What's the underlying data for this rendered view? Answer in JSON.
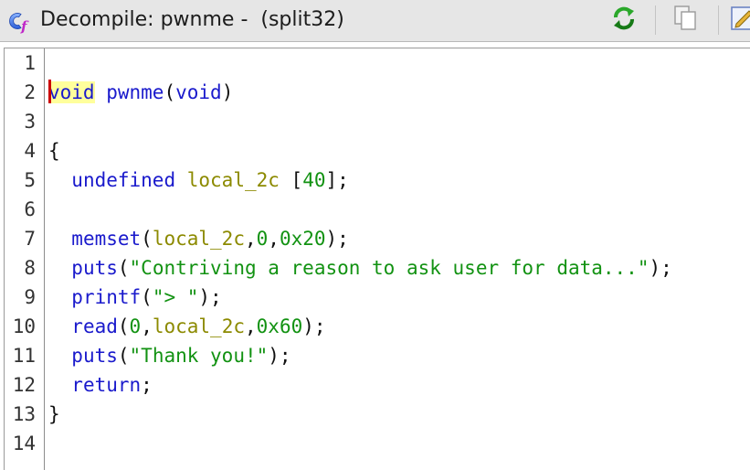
{
  "window": {
    "icon": "decompiler-cf-icon",
    "title": "Decompile: pwnme -  (split32)",
    "toolbar": [
      {
        "icon": "refresh-icon",
        "label": "Refresh"
      },
      {
        "icon": "copy-icon",
        "label": "Copy"
      },
      {
        "icon": "edit-icon",
        "label": "Edit"
      }
    ]
  },
  "colors": {
    "keyword": "#1a1acc",
    "variable": "#8c8a00",
    "literal": "#129212",
    "highlight": "#ffff9c",
    "cursor": "#cc0000"
  },
  "editor": {
    "line_numbers": [
      "1",
      "2",
      "3",
      "4",
      "5",
      "6",
      "7",
      "8",
      "9",
      "10",
      "11",
      "12",
      "13",
      "14"
    ],
    "lines": {
      "l2": {
        "t1": "void",
        "t2": " ",
        "t3": "pwnme",
        "t4": "(",
        "t5": "void",
        "t6": ")"
      },
      "l4": {
        "t1": "{"
      },
      "l5": {
        "t0": "  ",
        "t1": "undefined",
        "t2": " ",
        "t3": "local_2c",
        "t4": " [",
        "t5": "40",
        "t6": "];"
      },
      "l7": {
        "t0": "  ",
        "t1": "memset",
        "t2": "(",
        "t3": "local_2c",
        "t4": ",",
        "t5": "0",
        "t6": ",",
        "t7": "0x20",
        "t8": ");"
      },
      "l8": {
        "t0": "  ",
        "t1": "puts",
        "t2": "(",
        "t3": "\"Contriving a reason to ask user for data...\"",
        "t4": ");"
      },
      "l9": {
        "t0": "  ",
        "t1": "printf",
        "t2": "(",
        "t3": "\"> \"",
        "t4": ");"
      },
      "l10": {
        "t0": "  ",
        "t1": "read",
        "t2": "(",
        "t3": "0",
        "t4": ",",
        "t5": "local_2c",
        "t6": ",",
        "t7": "0x60",
        "t8": ");"
      },
      "l11": {
        "t0": "  ",
        "t1": "puts",
        "t2": "(",
        "t3": "\"Thank you!\"",
        "t4": ");"
      },
      "l12": {
        "t0": "  ",
        "t1": "return",
        "t2": ";"
      },
      "l13": {
        "t1": "}"
      }
    }
  }
}
